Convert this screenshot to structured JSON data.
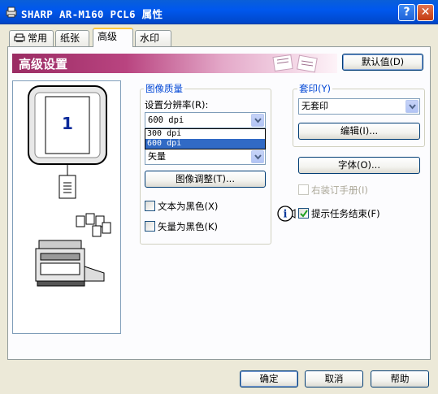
{
  "window": {
    "title": "SHARP AR-M160 PCL6 属性",
    "help_label": "?",
    "close_label": "✕"
  },
  "tabs": [
    {
      "label": "常用",
      "icon": "printer-icon",
      "active": false
    },
    {
      "label": "纸张",
      "active": false
    },
    {
      "label": "高级",
      "active": true
    },
    {
      "label": "水印",
      "active": false
    }
  ],
  "banner": {
    "title": "高级设置",
    "defaults_button": "默认值(D)"
  },
  "preview": {
    "page_number": "1"
  },
  "image_quality": {
    "group_title": "图像质量",
    "resolution_label": "设置分辨率(R):",
    "resolution_value": "600 dpi",
    "resolution_options": [
      "300 dpi",
      "600 dpi"
    ],
    "graphics_value": "矢量",
    "adjust_button": "图像调整(T)...",
    "text_black_label": "文本为黑色(X)",
    "vector_black_label": "矢量为黑色(K)"
  },
  "overlay": {
    "group_title": "套印(Y)",
    "value": "无套印",
    "edit_button": "编辑(I)..."
  },
  "font_button": "字体(O)...",
  "right_binding_label": "右装订手册(I)",
  "job_end_label": "提示任务结束(F)",
  "footer": {
    "ok": "确定",
    "cancel": "取消",
    "help": "帮助"
  },
  "colors": {
    "title_bar": "#0058ee",
    "banner_start": "#9a2b63",
    "group_title": "#0046d5",
    "selection": "#316ac5"
  }
}
